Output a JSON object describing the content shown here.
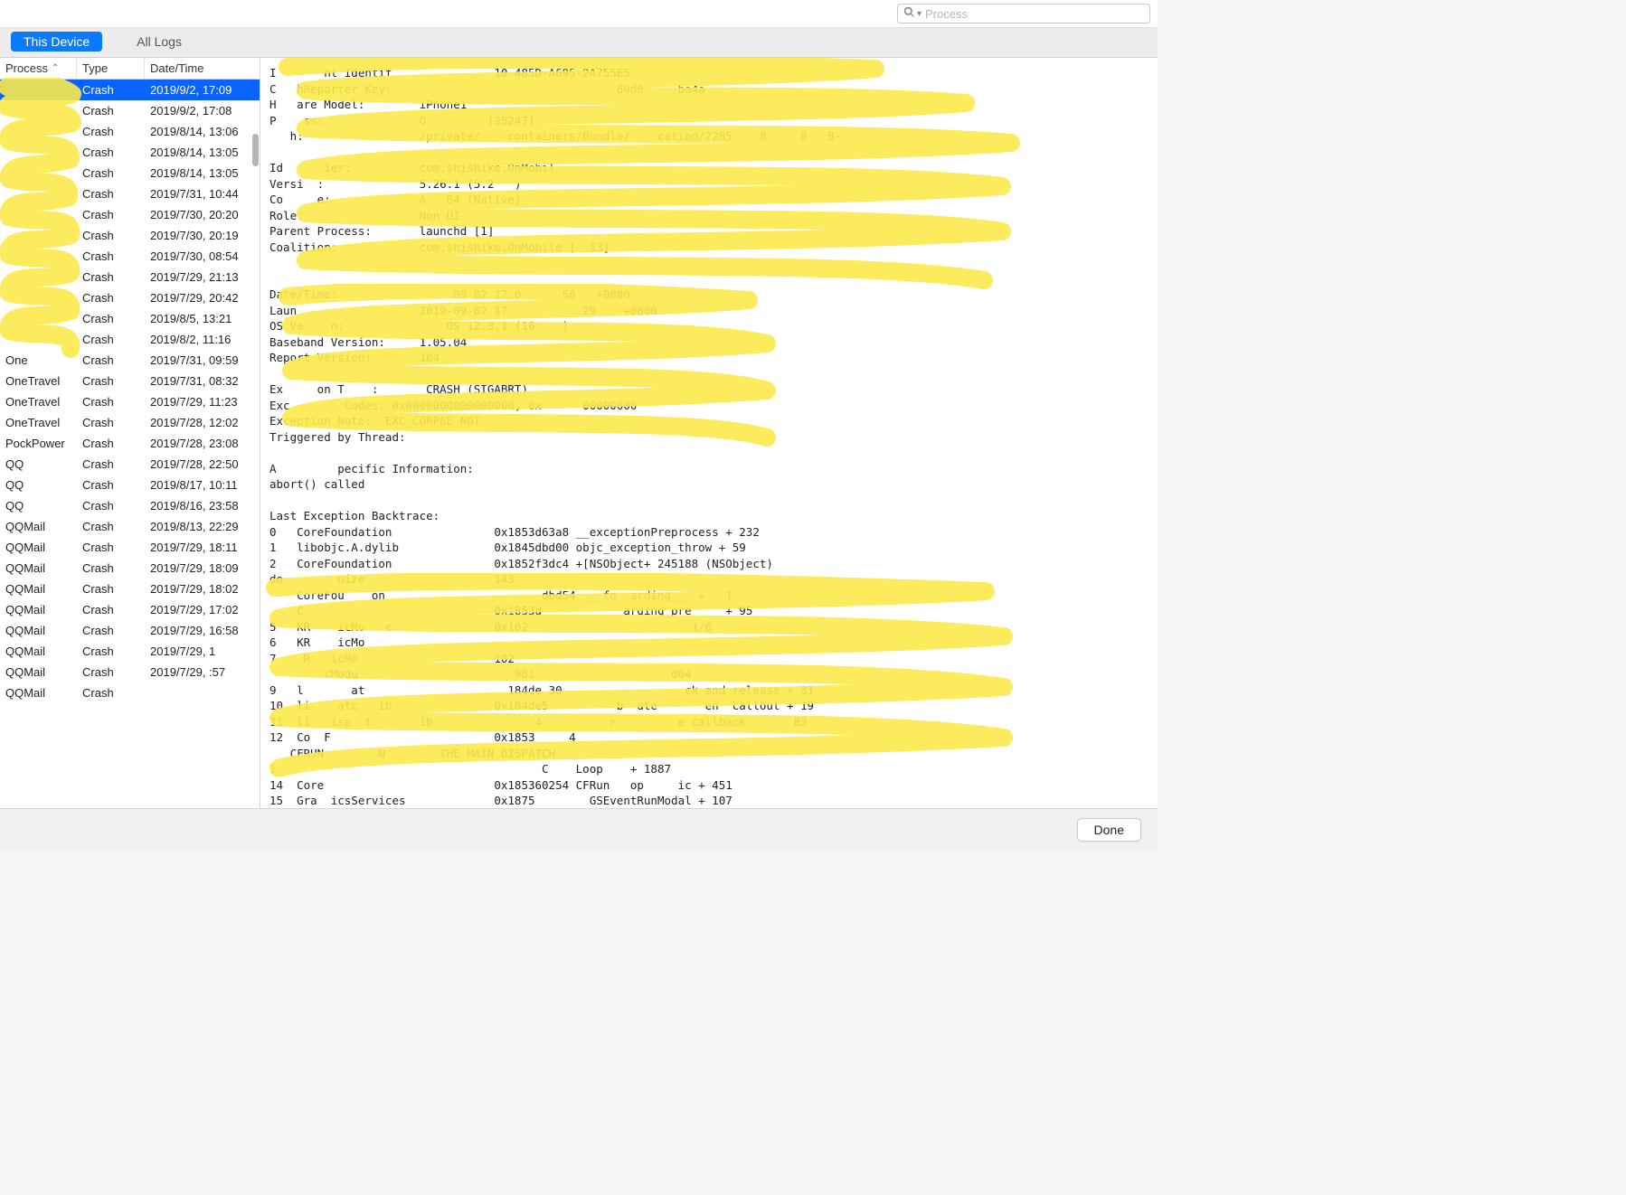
{
  "search": {
    "placeholder": "Process"
  },
  "tabs": {
    "this_device": "This Device",
    "all_logs": "All Logs"
  },
  "columns": {
    "process": "Process",
    "type": "Type",
    "date": "Date/Time"
  },
  "rows": [
    {
      "process": "",
      "type": "Crash",
      "date": "2019/9/2, 17:09",
      "selected": true
    },
    {
      "process": "",
      "type": "Crash",
      "date": "2019/9/2, 17:08"
    },
    {
      "process": "",
      "type": "Crash",
      "date": "2019/8/14, 13:06"
    },
    {
      "process": "",
      "type": "Crash",
      "date": "2019/8/14, 13:05"
    },
    {
      "process": "",
      "type": "Crash",
      "date": "2019/8/14, 13:05"
    },
    {
      "process": "",
      "type": "Crash",
      "date": "2019/7/31, 10:44"
    },
    {
      "process": "",
      "type": "Crash",
      "date": "2019/7/30, 20:20"
    },
    {
      "process": "",
      "type": "Crash",
      "date": "2019/7/30, 20:19"
    },
    {
      "process": "",
      "type": "Crash",
      "date": "2019/7/30, 08:54"
    },
    {
      "process": "",
      "type": "Crash",
      "date": "2019/7/29, 21:13"
    },
    {
      "process": "",
      "type": "Crash",
      "date": "2019/7/29, 20:42"
    },
    {
      "process": "",
      "type": "Crash",
      "date": "2019/8/5, 13:21"
    },
    {
      "process": "",
      "type": "Crash",
      "date": "2019/8/2, 11:16"
    },
    {
      "process": "One",
      "type": "Crash",
      "date": "2019/7/31, 09:59"
    },
    {
      "process": "OneTravel",
      "type": "Crash",
      "date": "2019/7/31, 08:32"
    },
    {
      "process": "OneTravel",
      "type": "Crash",
      "date": "2019/7/29, 11:23"
    },
    {
      "process": "OneTravel",
      "type": "Crash",
      "date": "2019/7/28, 12:02"
    },
    {
      "process": "PockPower",
      "type": "Crash",
      "date": "2019/7/28, 23:08"
    },
    {
      "process": "QQ",
      "type": "Crash",
      "date": "2019/7/28, 22:50"
    },
    {
      "process": "QQ",
      "type": "Crash",
      "date": "2019/8/17, 10:11"
    },
    {
      "process": "QQ",
      "type": "Crash",
      "date": "2019/8/16, 23:58"
    },
    {
      "process": "QQMail",
      "type": "Crash",
      "date": "2019/8/13, 22:29"
    },
    {
      "process": "QQMail",
      "type": "Crash",
      "date": "2019/7/29, 18:11"
    },
    {
      "process": "QQMail",
      "type": "Crash",
      "date": "2019/7/29, 18:09"
    },
    {
      "process": "QQMail",
      "type": "Crash",
      "date": "2019/7/29, 18:02"
    },
    {
      "process": "QQMail",
      "type": "Crash",
      "date": "2019/7/29, 17:02"
    },
    {
      "process": "QQMail",
      "type": "Crash",
      "date": "2019/7/29, 16:58"
    },
    {
      "process": "QQMail",
      "type": "Crash",
      "date": "2019/7/29, 1"
    },
    {
      "process": "QQMail",
      "type": "Crash",
      "date": "2019/7/29,   :57"
    },
    {
      "process": "QQMail",
      "type": "Crash",
      "date": ""
    }
  ],
  "detail_lines": [
    "I       nt Identif               10-485D-A695-2A755E5      ",
    "C   hReporter Key:                                 69d0     ba4a",
    "H   are Model:        iPhone1",
    "P    ss:              O         [25247]",
    "   h:                 /private/    containers/Bundle/    cation/2285    8     8   B-",
    "",
    "Id      ier:          com.shishike.OnMobil",
    "Versi  :              5.26.1 (5.2   )",
    "Co     e:             A   64 (Native)",
    "Role:                 Non UI",
    "Parent Process:       launchd [1]",
    "Coalition:            com.shishike.OnMobile [  13]",
    "",
    "",
    "Date/Time:                 09 02 17:0      56   +0800",
    "Laun        :         2019-09-02 17:         .29    +0800",
    "OS Ve    n:               OS 12.3.1 (16    )",
    "Baseband Version:     1.05.04",
    "Report Version:       104",
    "",
    "Ex     on T    :       CRASH (SIGABRT)",
    "Exc        Codes: 0x0000000000000000, 0x      00000000",
    "Exception Note:  EXC_CORPSE NOT",
    "Triggered by Thread:",
    "",
    "A         pecific Information:",
    "abort() called",
    "",
    "Last Exception Backtrace:",
    "0   CoreFoundation               0x1853d63a8 __exceptionPreprocess + 232",
    "1   libobjc.A.dylib              0x1845dbd00 objc_exception_throw + 59",
    "2   CoreFoundation               0x1852f3dc4 +[NSObject+ 245188 (NSObject)",
    "do        nize                   143",
    "    CoreFou    on                       dbd54 ___fo  arding___ +   1",
    "    C                            0x1853d            arding_pre     + 95",
    "5   KR    icMo   e               0x102                        1/6",
    "6   KR    icMo                   ",
    "7    R   icMo                    102                          ",
    "        cModu                       981                    004",
    "9   l       at                     184de 30                  ck and release + 31",
    "10  li    atc   ib               0x184de5          b  ate       en  callout + 19",
    "11  li   isp  t   .   ib               4          n         e callback       83",
    "12  Co  F                        0x1853     4",
    "   CFRUN        N        THE MAIN DISPATCH",
    "1                                       C    Loop    + 1887",
    "14  Core                         0x185360254 CFRun   op     ic + 451",
    "15  Gra  icsServices             0x1875        GSEventRunModal + 107"
  ],
  "footer": {
    "done": "Done"
  }
}
